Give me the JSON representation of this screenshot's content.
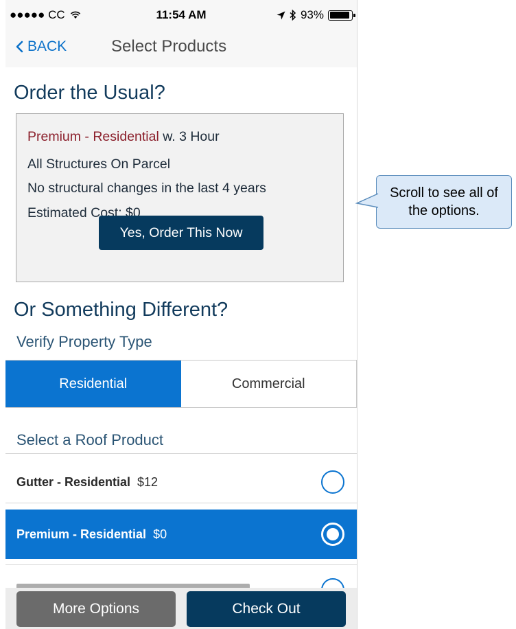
{
  "status_bar": {
    "carrier": "●●●●● CC",
    "wifi_icon": "wifi-icon",
    "time": "11:54 AM",
    "location_icon": "location-arrow-icon",
    "bluetooth_icon": "bluetooth-icon",
    "battery_percent": "93%",
    "battery_level": 0.93
  },
  "nav": {
    "back_label": "BACK",
    "title": "Select Products"
  },
  "usual": {
    "heading": "Order the Usual?",
    "product": "Premium - Residential",
    "product_suffix": "w. 3 Hour",
    "line2": "All Structures On Parcel",
    "line3": "No structural changes in the last 4 years",
    "line4": "Estimated Cost: $0",
    "order_button": "Yes, Order This Now"
  },
  "different": {
    "heading": "Or Something Different?",
    "verify_label": "Verify Property Type",
    "property_types": [
      {
        "label": "Residential",
        "selected": true
      },
      {
        "label": "Commercial",
        "selected": false
      }
    ],
    "roof_label": "Select a Roof Product",
    "products": [
      {
        "name": "Gutter - Residential",
        "price": "$12",
        "selected": false
      },
      {
        "name": "Premium - Residential",
        "price": "$0",
        "selected": true
      }
    ]
  },
  "footer": {
    "more_options": "More Options",
    "check_out": "Check Out"
  },
  "callout": {
    "text": "Scroll to see all of the options."
  },
  "colors": {
    "accent": "#0b74d0",
    "navy": "#063a5e",
    "product_red": "#8b1f2b",
    "heading_blue": "#123b5c"
  }
}
